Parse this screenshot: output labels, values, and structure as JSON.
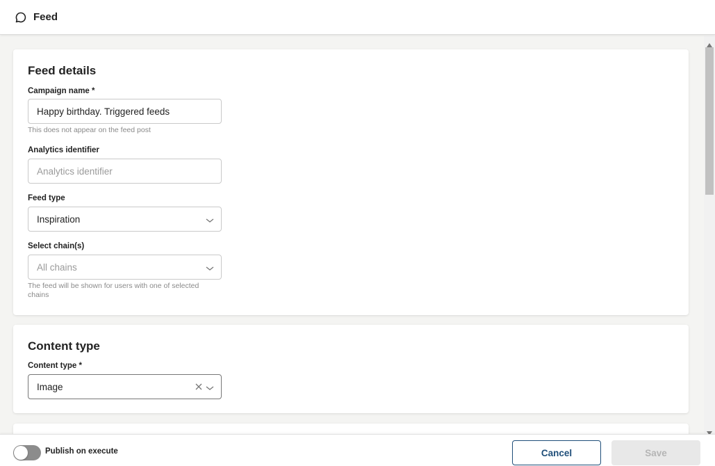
{
  "header": {
    "title": "Feed",
    "icon": "chat-bubble-icon"
  },
  "feed_details": {
    "title": "Feed details",
    "campaign_name": {
      "label": "Campaign name *",
      "value": "Happy birthday. Triggered feeds",
      "hint": "This does not appear on the feed post"
    },
    "analytics_identifier": {
      "label": "Analytics identifier",
      "placeholder": "Analytics identifier"
    },
    "feed_type": {
      "label": "Feed type",
      "value": "Inspiration"
    },
    "chains": {
      "label": "Select chain(s)",
      "placeholder": "All chains",
      "hint": "The feed will be shown for users with one of selected chains"
    }
  },
  "content_type": {
    "title": "Content type",
    "field": {
      "label": "Content type *",
      "value": "Image"
    }
  },
  "footer": {
    "toggle_label": "Publish on execute",
    "toggle_on": false,
    "cancel_label": "Cancel",
    "save_label": "Save"
  },
  "colors": {
    "primary": "#1f4e79",
    "disabled": "#e8e8e8",
    "background": "#f4f4f2"
  }
}
